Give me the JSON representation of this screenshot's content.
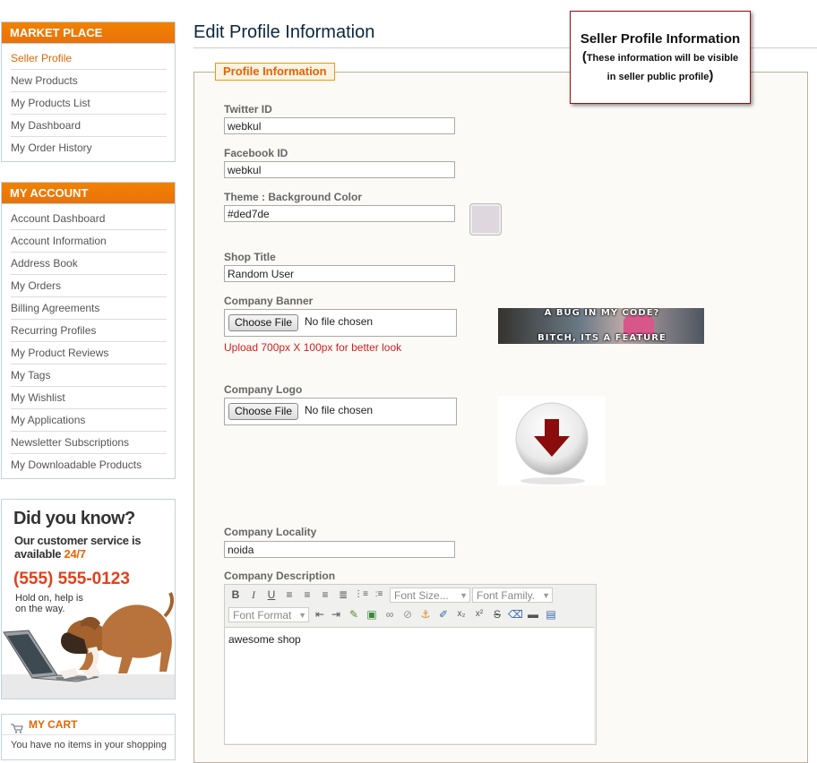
{
  "marketplace": {
    "title": "MARKET PLACE",
    "items": [
      "Seller Profile",
      "New Products",
      "My Products List",
      "My Dashboard",
      "My Order History"
    ]
  },
  "account": {
    "title": "MY ACCOUNT",
    "items": [
      "Account Dashboard",
      "Account Information",
      "Address Book",
      "My Orders",
      "Billing Agreements",
      "Recurring Profiles",
      "My Product Reviews",
      "My Tags",
      "My Wishlist",
      "My Applications",
      "Newsletter Subscriptions",
      "My Downloadable Products"
    ]
  },
  "ad": {
    "headline": "Did you know?",
    "line1": "Our customer service is",
    "line2_prefix": "available ",
    "line2_highlight": "24/7",
    "phone": "(555) 555-0123",
    "hold1": "Hold on, help is",
    "hold2": "on the way."
  },
  "cart": {
    "title": "MY CART",
    "text": "You have no items in your shopping"
  },
  "page": {
    "title": "Edit Profile Information",
    "legend": "Profile Information"
  },
  "form": {
    "twitter_label": "Twitter ID",
    "twitter_value": "webkul",
    "facebook_label": "Facebook ID",
    "facebook_value": "webkul",
    "theme_label": "Theme : Background Color",
    "theme_value": "#ded7de",
    "shop_title_label": "Shop Title",
    "shop_title_value": "Random User",
    "banner_label": "Company Banner",
    "choose_file": "Choose File",
    "no_file": "No file chosen",
    "banner_hint": "Upload 700px X 100px for better look",
    "banner_text_top": "A BUG IN MY CODE?",
    "banner_text_bottom": "BITCH, ITS A FEATURE",
    "logo_label": "Company Logo",
    "locality_label": "Company Locality",
    "locality_value": "noida",
    "description_label": "Company Description",
    "description_value": "awesome shop"
  },
  "editor": {
    "font_size": "Font Size...",
    "font_family": "Font Family.",
    "font_format": "Font Format"
  },
  "callout": {
    "title": "Seller Profile Information",
    "sub_open": "(",
    "sub1": "These information will be visible",
    "sub2": "in seller public profile",
    "sub_close": ")"
  },
  "colors": {
    "accent": "#e26703",
    "swatch": "#ded7de",
    "header_orange": "#f18200"
  }
}
